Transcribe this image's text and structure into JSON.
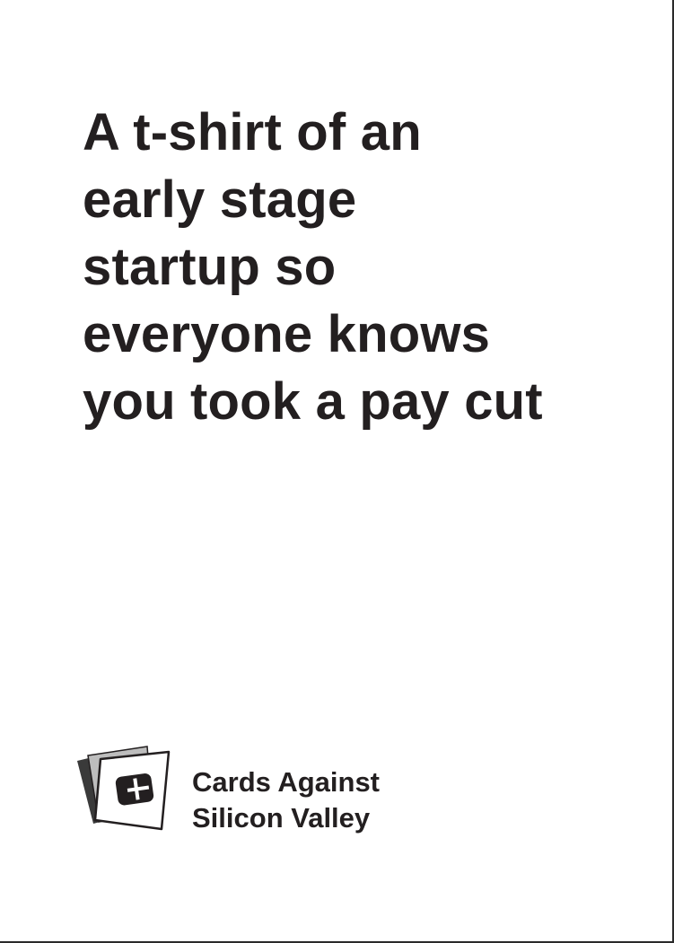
{
  "card": {
    "text_lines": [
      "A t-shirt of an",
      "early stage",
      "startup so",
      "everyone knows",
      "you took a pay cut"
    ]
  },
  "brand": {
    "name_lines": [
      "Cards Against",
      "Silicon Valley"
    ],
    "logo_icon": "stacked-cards-chip-icon"
  },
  "colors": {
    "text": "#231f20",
    "background": "#ffffff",
    "card_back_dark": "#3a3a3a",
    "card_back_mid": "#bdbdbd"
  }
}
